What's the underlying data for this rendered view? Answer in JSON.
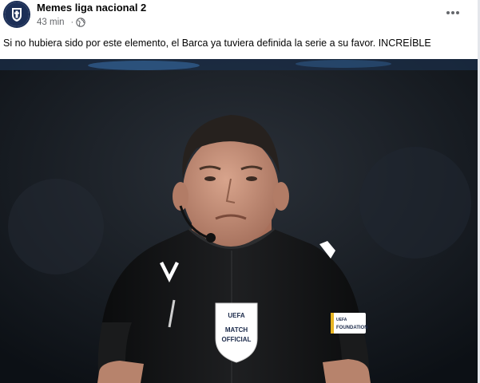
{
  "post": {
    "page_name": "Memes liga nacional 2",
    "timestamp": "43 min",
    "meta_separator": "·",
    "audience_icon": "globe-icon",
    "more_icon": "more-options-icon",
    "caption": "Si no hubiera sido por este elemento, el Barca ya tuviera definida la serie a su favor. INCREÍBLE",
    "avatar_icon": "club-crest-icon"
  },
  "photo": {
    "badge_top": "UEFA",
    "badge_middle": "MATCH",
    "badge_bottom": "OFFICIAL",
    "patch_small": "UEFA",
    "patch_text": "FOUNDATION",
    "colors": {
      "background": "#10141a",
      "jersey": "#141516",
      "skin": "#c48f78",
      "hair": "#26211e",
      "patch_accent": "#e7b524"
    }
  }
}
